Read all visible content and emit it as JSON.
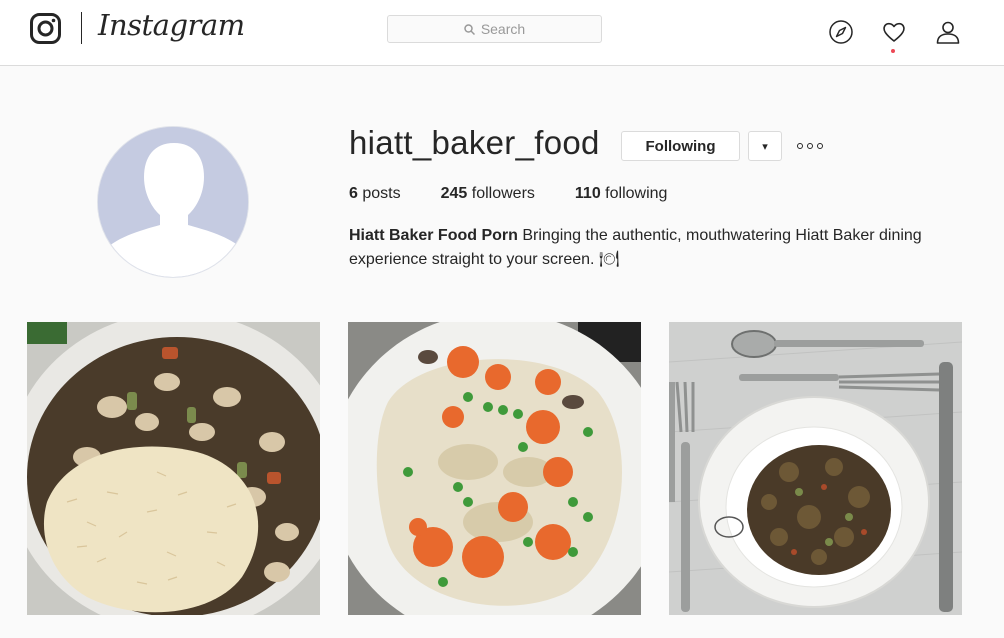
{
  "header": {
    "wordmark": "Instagram",
    "logo_icon": "camera-icon",
    "search": {
      "placeholder": "Search",
      "icon": "search-icon"
    },
    "nav": [
      {
        "icon": "compass-icon",
        "label": "Explore"
      },
      {
        "icon": "heart-icon",
        "label": "Activity",
        "has_notification": true
      },
      {
        "icon": "person-icon",
        "label": "Profile"
      }
    ]
  },
  "profile": {
    "username": "hiatt_baker_food",
    "following_button": "Following",
    "dropdown_button": "▾",
    "more_button": "options-icon",
    "stats": {
      "posts_count": "6",
      "posts_label": "posts",
      "followers_count": "245",
      "followers_label": "followers",
      "following_count": "110",
      "following_label": "following"
    },
    "bio": {
      "name": "Hiatt Baker Food Porn",
      "text": "Bringing the authentic, mouthwatering Hiatt Baker dining experience straight to your screen. 🍽"
    },
    "avatar": "default-avatar-icon"
  },
  "posts": [
    {
      "alt": "stew-with-beans-and-rice"
    },
    {
      "alt": "chicken-pot-pie-filling-with-carrots-and-peas"
    },
    {
      "alt": "mushroom-stew-bowl-with-silverware"
    }
  ],
  "colors": {
    "text": "#262626",
    "border": "#dbdbdb",
    "background": "#fafafa",
    "notification": "#ed4956",
    "avatar_bg": "#c5cbe1"
  }
}
